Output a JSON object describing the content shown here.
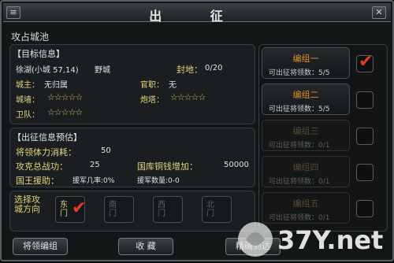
{
  "window": {
    "title": "出 征",
    "left_icon": "menu-icon",
    "close_icon": "close-icon"
  },
  "section_title": "攻占城池",
  "target": {
    "heading": "【目标信息】",
    "location": "徐湖(小城 57,14)",
    "type": "野城",
    "fief_label": "封地：",
    "fief_value": "0/20",
    "lord_label": "城主：",
    "lord_value": "无归属",
    "official_label": "官职：",
    "official_value": "无",
    "wall_label": "城墙：",
    "wall_stars": "☆☆☆☆☆",
    "tower_label": "炮塔：",
    "tower_stars": "☆☆☆☆☆",
    "guard_label": "卫队：",
    "guard_stars": "☆☆☆☆☆"
  },
  "forecast": {
    "heading": "【出征信息预估】",
    "stamina_label": "将领体力消耗：",
    "stamina_value": "50",
    "merit_label": "攻克总战功：",
    "merit_value": "25",
    "copper_label": "国库铜钱增加：",
    "copper_value": "50000",
    "aid_label": "国王援助：",
    "aid_rate": "援军几率:0%",
    "aid_count": "援军数量:0-0"
  },
  "direction": {
    "label": "选择攻城方向",
    "gates": [
      {
        "label": "东门",
        "selected": true
      },
      {
        "label": "南门",
        "selected": false
      },
      {
        "label": "西门",
        "selected": false
      },
      {
        "label": "北门",
        "selected": false
      }
    ]
  },
  "groups": [
    {
      "name": "编组一",
      "count": "可出征将领数：5/5",
      "enabled": true,
      "checked": true
    },
    {
      "name": "编组二",
      "count": "可出征将领数：5/5",
      "enabled": true,
      "checked": false
    },
    {
      "name": "编组三",
      "count": "可出征将领数：0/1",
      "enabled": false,
      "checked": false
    },
    {
      "name": "编组四",
      "count": "可出征将领数：0/1",
      "enabled": false,
      "checked": false
    },
    {
      "name": "编组五",
      "count": "可出征将领数：0/1",
      "enabled": false,
      "checked": false
    }
  ],
  "buttons": {
    "general_group": "将领编组",
    "favorite": "收 藏",
    "precise_arrive": "精确到达"
  },
  "watermark": {
    "logo_text": "37Y.net"
  }
}
